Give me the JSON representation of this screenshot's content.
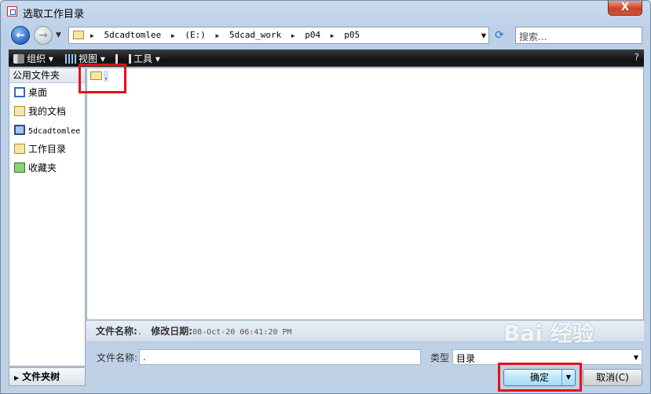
{
  "window": {
    "title": "选取工作目录",
    "close_label": "X"
  },
  "nav": {
    "back_glyph": "←",
    "forward_glyph": "→",
    "breadcrumb": [
      "5dcadtomlee",
      "(E:)",
      "5dcad_work",
      "p04",
      "p05"
    ],
    "search_placeholder": "搜索..."
  },
  "toolbar": {
    "organize": "组织",
    "views": "视图",
    "tools": "工具"
  },
  "sidebar": {
    "header": "公用文件夹",
    "items": [
      {
        "label": "桌面",
        "icon": "desktop-icon"
      },
      {
        "label": "我的文档",
        "icon": "my-documents-icon"
      },
      {
        "label": "5dcadtomlee",
        "icon": "computer-icon"
      },
      {
        "label": "工作目录",
        "icon": "working-directory-icon"
      },
      {
        "label": "收藏夹",
        "icon": "favorites-icon"
      }
    ],
    "folder_tree_label": "文件夹树"
  },
  "files": [
    {
      "name": ".",
      "icon": "folder-icon"
    }
  ],
  "details": {
    "name_label": "文件名称:",
    "name_value": ".",
    "modified_label": "修改日期:",
    "modified_value": "08-Oct-20 06:41:20 PM"
  },
  "form": {
    "filename_label": "文件名称:",
    "filename_value": ".",
    "type_label": "类型",
    "type_value": "目录",
    "ok_label": "确定",
    "cancel_label": "取消(C)"
  },
  "watermark": "Bai 经验",
  "colors": {
    "highlight": "#e6101a",
    "toolbar_bg": "#1a1a1a",
    "accent": "#2b6ccf"
  }
}
